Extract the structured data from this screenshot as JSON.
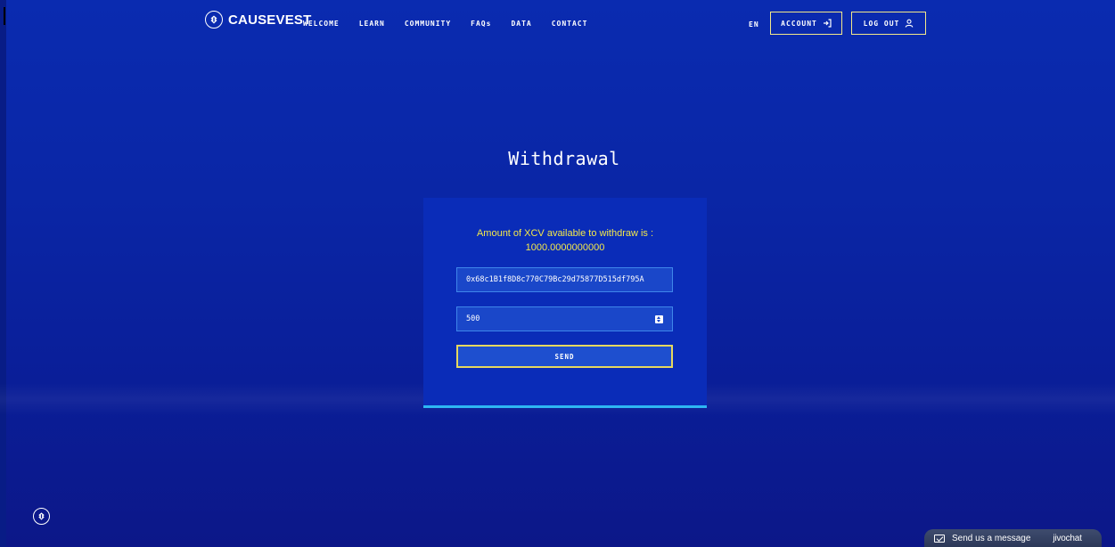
{
  "nav": {
    "brand": "CAUSEVEST",
    "items": [
      "WELCOME",
      "LEARN",
      "COMMUNITY",
      "FAQs",
      "DATA",
      "CONTACT"
    ],
    "lang": "EN",
    "account_label": "ACCOUNT",
    "logout_label": "LOG OUT"
  },
  "page": {
    "title": "Withdrawal"
  },
  "form": {
    "available_line1": "Amount of XCV available to withdraw is :",
    "available_line2": "1000.0000000000",
    "address_value": "0x68c1B1f8D8c770C79Bc29d75877D515df795A",
    "amount_value": "500",
    "send_label": "SEND"
  },
  "chat": {
    "label": "Send us a message",
    "brand": "jivochat"
  },
  "colors": {
    "accent_yellow": "#f3e84a",
    "underline_blue": "#2db7f3",
    "background": "#0a26a6"
  },
  "icons": {
    "logo": "causevest-logo-icon",
    "account": "login-arrow-icon",
    "logout": "user-icon",
    "stepper": "number-stepper-icon",
    "chat": "message-icon"
  }
}
